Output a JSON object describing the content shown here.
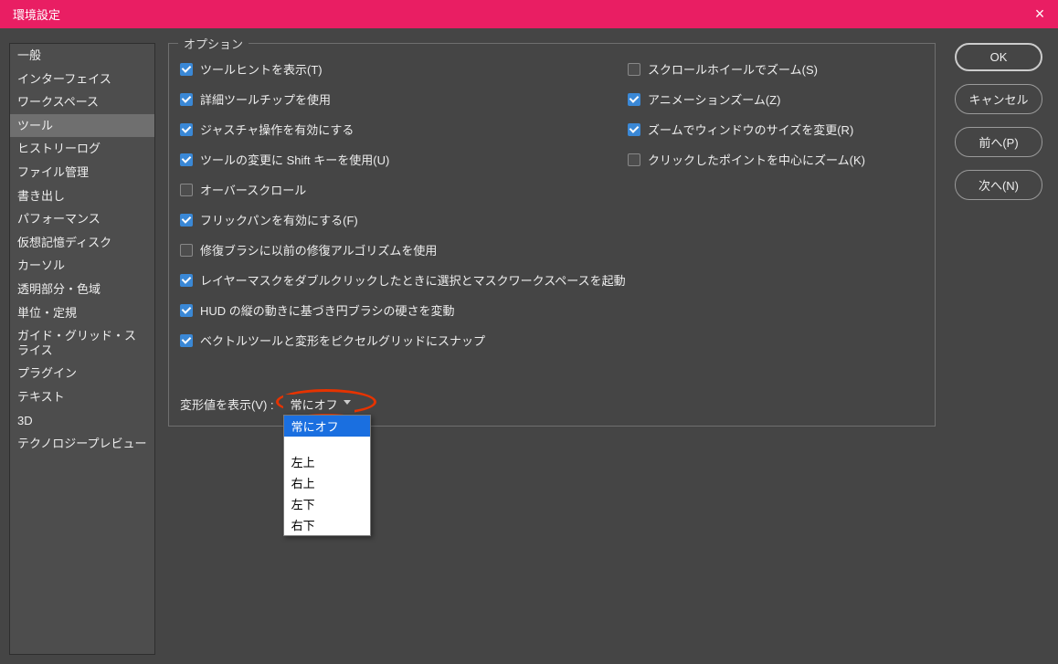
{
  "title": "環境設定",
  "sidebar": {
    "items": [
      {
        "label": "一般"
      },
      {
        "label": "インターフェイス"
      },
      {
        "label": "ワークスペース"
      },
      {
        "label": "ツール"
      },
      {
        "label": "ヒストリーログ"
      },
      {
        "label": "ファイル管理"
      },
      {
        "label": "書き出し"
      },
      {
        "label": "パフォーマンス"
      },
      {
        "label": "仮想記憶ディスク"
      },
      {
        "label": "カーソル"
      },
      {
        "label": "透明部分・色域"
      },
      {
        "label": "単位・定規"
      },
      {
        "label": "ガイド・グリッド・スライス"
      },
      {
        "label": "プラグイン"
      },
      {
        "label": "テキスト"
      },
      {
        "label": "3D"
      },
      {
        "label": "テクノロジープレビュー"
      }
    ],
    "selected_index": 3
  },
  "fieldset_legend": "オプション",
  "options_left": [
    {
      "label": "ツールヒントを表示(T)",
      "checked": true
    },
    {
      "label": "詳細ツールチップを使用",
      "checked": true
    },
    {
      "label": "ジャスチャ操作を有効にする",
      "checked": true
    },
    {
      "label": "ツールの変更に Shift キーを使用(U)",
      "checked": true
    },
    {
      "label": "オーバースクロール",
      "checked": false
    },
    {
      "label": "フリックパンを有効にする(F)",
      "checked": true
    },
    {
      "label": "修復ブラシに以前の修復アルゴリズムを使用",
      "checked": false
    },
    {
      "label": "レイヤーマスクをダブルクリックしたときに選択とマスクワークスペースを起動",
      "checked": true
    },
    {
      "label": "HUD の縦の動きに基づき円ブラシの硬さを変動",
      "checked": true
    },
    {
      "label": "ベクトルツールと変形をピクセルグリッドにスナップ",
      "checked": true
    }
  ],
  "options_right": [
    {
      "label": "スクロールホイールでズーム(S)",
      "checked": false
    },
    {
      "label": "アニメーションズーム(Z)",
      "checked": true
    },
    {
      "label": "ズームでウィンドウのサイズを変更(R)",
      "checked": true
    },
    {
      "label": "クリックしたポイントを中心にズーム(K)",
      "checked": false
    }
  ],
  "transform": {
    "label": "変形値を表示(V) :",
    "selected": "常にオフ",
    "options": [
      "常にオフ",
      "",
      "左上",
      "右上",
      "左下",
      "右下"
    ]
  },
  "buttons": {
    "ok": "OK",
    "cancel": "キャンセル",
    "prev": "前へ(P)",
    "next": "次へ(N)"
  }
}
